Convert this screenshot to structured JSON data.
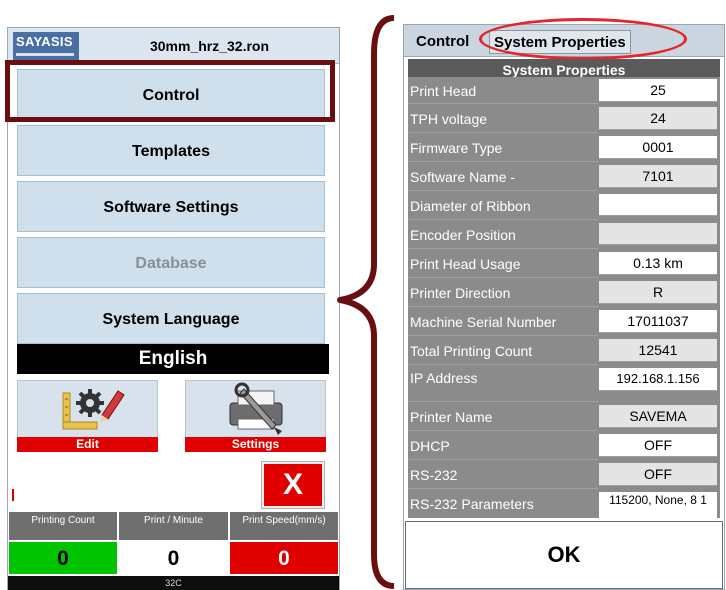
{
  "left_panel": {
    "logo_text": "SAYASIS",
    "filename": "30mm_hrz_32.ron",
    "menu": {
      "control": "Control",
      "templates": "Templates",
      "software_settings": "Software Settings",
      "database": "Database",
      "system_language": "System Language"
    },
    "language": "English",
    "tiles": {
      "edit": "Edit",
      "settings": "Settings"
    },
    "close_label": "X",
    "stats": {
      "printing_count_label": "Printing Count",
      "printing_count_value": "0",
      "print_per_minute_label": "Print / Minute",
      "print_per_minute_value": "0",
      "print_speed_label": "Print Speed(mm/s)",
      "print_speed_value": "0"
    },
    "footer": "32C"
  },
  "right_panel": {
    "tabs": {
      "control": "Control",
      "system_properties": "System Properties"
    },
    "table_header": "System Properties",
    "rows": [
      {
        "key": "Print Head",
        "value": "25"
      },
      {
        "key": "TPH voltage",
        "value": "24"
      },
      {
        "key": "Firmware Type",
        "value": "0001"
      },
      {
        "key": "Software Name -",
        "value": "7101"
      },
      {
        "key": "Diameter of Ribbon",
        "value": ""
      },
      {
        "key": "Encoder Position",
        "value": ""
      },
      {
        "key": "Print Head Usage",
        "value": "0.13 km"
      },
      {
        "key": "Printer Direction",
        "value": "R"
      },
      {
        "key": "Machine Serial Number",
        "value": "17011037"
      },
      {
        "key": "Total Printing Count",
        "value": "12541"
      },
      {
        "key": "IP Address",
        "value": "192.168.1.156"
      },
      {
        "key": "Printer Name",
        "value": "SAVEMA"
      },
      {
        "key": "DHCP",
        "value": "OFF"
      },
      {
        "key": "RS-232",
        "value": "OFF"
      },
      {
        "key": "RS-232 Parameters",
        "value": "115200, None, 8 1"
      }
    ],
    "ok_label": "OK"
  },
  "colors": {
    "highlight_box": "#6a0f0f",
    "ellipse": "#e6252a",
    "alert_red": "#e00000",
    "ok_green": "#00c400",
    "menu_blue": "#cfe0ec"
  },
  "icons": {
    "edit_tile": "ruler-gear-pencil-icon",
    "settings_tile": "printer-wrench-icon",
    "brace": "curly-brace-icon"
  }
}
